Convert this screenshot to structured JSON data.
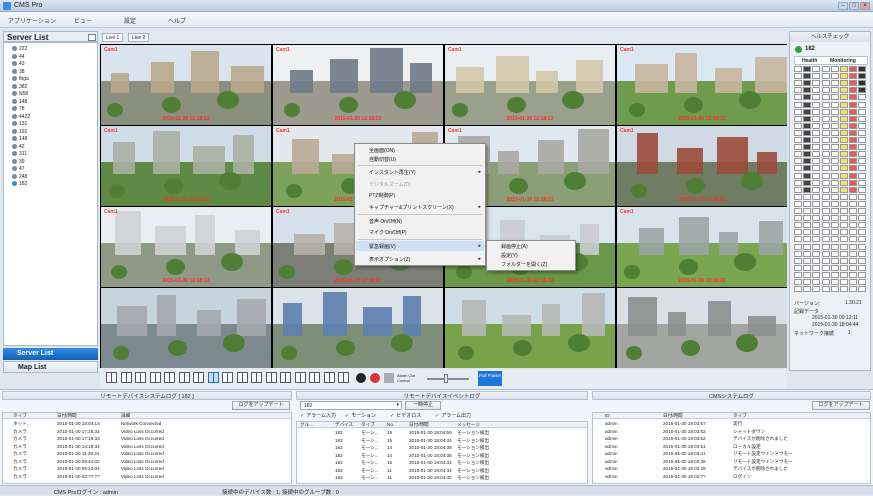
{
  "app": {
    "title": "CMS Pro"
  },
  "menu": [
    "アプリケーション",
    "ビュー",
    "設定",
    "ヘルプ"
  ],
  "server_list": {
    "title": "Server List",
    "items": [
      "222",
      "44",
      "43",
      "38",
      "fbga",
      "382",
      "N58",
      "148",
      "78",
      "4422",
      "131",
      "191",
      "148",
      "42",
      "311",
      "39",
      "47",
      "248",
      "182"
    ]
  },
  "nav": {
    "server_list": "Server List",
    "map_list": "Map List"
  },
  "tabs": [
    "Live 1",
    "Live 2"
  ],
  "cameras": [
    {
      "label": "Cam1",
      "ts": "2015-01-30 12:18:22"
    },
    {
      "label": "Cam1",
      "ts": "2015-01-30 12:18:22"
    },
    {
      "label": "Cam1",
      "ts": "2015-01-30 12:18:22"
    },
    {
      "label": "Cam1",
      "ts": "2015-01-30 12:18:22"
    },
    {
      "label": "Cam1",
      "ts": "2015-01-30 12:18:22"
    },
    {
      "label": "Cam1",
      "ts": "2015-01-30 12:18:22"
    },
    {
      "label": "Cam1",
      "ts": "2015-01-30 12:18:22"
    },
    {
      "label": "Cam1",
      "ts": "2015-01-30 12:18:22"
    },
    {
      "label": "Cam1",
      "ts": "2015-01-30 12:18:22"
    },
    {
      "label": "Cam1",
      "ts": "2015-01-30 12:18:22"
    },
    {
      "label": "Cam1",
      "ts": "2015-01-30 12:18:22"
    },
    {
      "label": "Cam1",
      "ts": "2015-01-30 12:18:22"
    },
    {
      "label": "",
      "ts": ""
    },
    {
      "label": "",
      "ts": ""
    },
    {
      "label": "",
      "ts": ""
    },
    {
      "label": "",
      "ts": ""
    }
  ],
  "context_menu": {
    "items": [
      "全画面(ON)",
      "自動切替(U)",
      "インスタント再生(Y)",
      "デジタルズーム(D)",
      "PTZ制御(P)",
      "キャプチャー&プリントスクリーン(X)",
      "音声 On/Off(N)",
      "マイク On/Off(P)",
      "緊急録画(V)",
      "表示オプション(Z)"
    ],
    "submenu": [
      "録画停止(A)",
      "設定(Y)",
      "フォルダーを開く(Z)"
    ]
  },
  "right_panel": {
    "title": "ヘルスチェック",
    "server": "182",
    "col1": "Health",
    "col2": "Monitoring",
    "version_label": "バージョン:",
    "version": "1.30.21",
    "rec_label": "記録データ",
    "rec_from": "2015-01-30 09:12:11",
    "rec_to": "2015-01-30 18:04:44",
    "net_label": "ネットワーク接続",
    "net_value": "1"
  },
  "toolbar": {
    "alarm_out": "Alarm Out Control",
    "full_frame": "Full Frame"
  },
  "panel1": {
    "title": "リモートデバイスシステムログ [ 182 ]",
    "button": "ログをアップデート",
    "headers": [
      "タイプ",
      "日付/時間",
      "詳細"
    ],
    "rows": [
      [
        "ネット...",
        "2015-01-30 18:04:13",
        "Network Connected"
      ],
      [
        "カメラ",
        "2015-01-30 17:16:34",
        "Video Loss Occurred"
      ],
      [
        "カメラ",
        "2015-01-30 17:16:33",
        "Video Loss Occurred"
      ],
      [
        "カメラ",
        "2015-01-30 14:18:34",
        "Video Loss Occurred"
      ],
      [
        "カメラ",
        "2015-01-30 11:28:24",
        "Video Loss Occurred"
      ],
      [
        "カメラ",
        "2015-01-30 08:41:02",
        "Video Loss Occurred"
      ],
      [
        "カメラ",
        "2015-01-30 05:23:04",
        "Video Loss Occurred"
      ],
      [
        "カメラ",
        "2015-01-30 03:??:??",
        "Video Loss Occurred"
      ]
    ]
  },
  "panel2": {
    "title": "リモートデバイスイベントログ",
    "select": "182",
    "button": "一時停止",
    "checks": [
      "アラーム入力",
      "モーション",
      "ビデオロス",
      "アラーム出力"
    ],
    "headers": [
      "グル...",
      "デバイス",
      "タイプ",
      "No.",
      "日付/時間",
      "メッセージ"
    ],
    "rows": [
      [
        "",
        "182",
        "モーシ...",
        "16",
        "2015-01-30 18:04:56",
        "モーション検出"
      ],
      [
        "",
        "182",
        "モーシ...",
        "16",
        "2015-01-30 18:04:44",
        "モーション検出"
      ],
      [
        "",
        "182",
        "モーシ...",
        "14",
        "2015-01-30 18:04:38",
        "モーション検出"
      ],
      [
        "",
        "182",
        "モーシ...",
        "14",
        "2015-01-30 18:04:38",
        "モーション検出"
      ],
      [
        "",
        "182",
        "モーシ...",
        "16",
        "2015-01-30 18:04:34",
        "モーション検出"
      ],
      [
        "",
        "182",
        "モーシ...",
        "11",
        "2015-01-30 18:04:34",
        "モーション検出"
      ],
      [
        "",
        "182",
        "モーシ...",
        "11",
        "2015-01-30 18:04:30",
        "モーション検出"
      ]
    ]
  },
  "panel3": {
    "title": "CMSシステムログ",
    "button": "ログをアップデート",
    "headers": [
      "ID",
      "日付/時間",
      "タイプ"
    ],
    "rows": [
      [
        "admin",
        "2015-01-30 18:03:57",
        "実行"
      ],
      [
        "admin",
        "2015-01-30 18:03:52",
        "シャットダウン"
      ],
      [
        "admin",
        "2015-01-30 18:03:52",
        "デバイスが削除されました"
      ],
      [
        "admin",
        "2015-01-30 18:03:51",
        "ローカル設定"
      ],
      [
        "admin",
        "2015-01-30 18:03:41",
        "リモート設定ウインドウモー"
      ],
      [
        "admin",
        "2015-01-30 18:03:36",
        "リモート設定ウインドウモー"
      ],
      [
        "admin",
        "2015-01-30 18:02:26",
        "デバイスが削除されました"
      ],
      [
        "admin",
        "2015-01-30 18:02:??",
        "ログイン"
      ]
    ]
  },
  "status": {
    "left": "CMS Proログイン : admin",
    "right": "接続中のデバイス数 : 1, 接続中のグループ数 : 0"
  },
  "colors": {
    "accent": "#1e78d8",
    "cam_text": "#ff2a2a",
    "alert": "#e03030"
  }
}
